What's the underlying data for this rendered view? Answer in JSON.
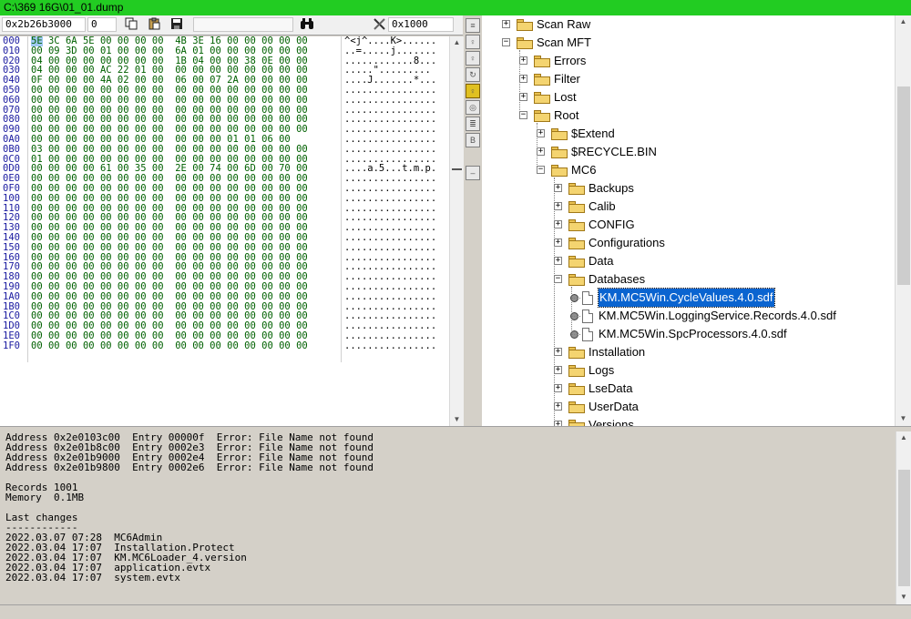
{
  "window": {
    "title": "C:\\369 16G\\01_01.dump"
  },
  "hex_toolbar": {
    "address": "0x2b26b3000",
    "offset": "0",
    "search_value": "",
    "zoom": "0x1000"
  },
  "hex": {
    "rows": [
      {
        "addr": "000",
        "bytes": [
          "5E",
          "3C",
          "6A",
          "5E",
          "00",
          "00",
          "00",
          "00",
          "4B",
          "3E",
          "16",
          "00",
          "00",
          "00",
          "00",
          "00"
        ],
        "ascii": "^<j^....K>......"
      },
      {
        "addr": "010",
        "bytes": [
          "00",
          "09",
          "3D",
          "00",
          "01",
          "00",
          "00",
          "00",
          "6A",
          "01",
          "00",
          "00",
          "00",
          "00",
          "00",
          "00"
        ],
        "ascii": "..=.....j......."
      },
      {
        "addr": "020",
        "bytes": [
          "04",
          "00",
          "00",
          "00",
          "00",
          "00",
          "00",
          "00",
          "1B",
          "04",
          "00",
          "00",
          "38",
          "0E",
          "00",
          "00"
        ],
        "ascii": "............8..."
      },
      {
        "addr": "030",
        "bytes": [
          "04",
          "00",
          "00",
          "00",
          "AC",
          "22",
          "01",
          "00",
          "00",
          "00",
          "00",
          "00",
          "00",
          "00",
          "00",
          "00"
        ],
        "ascii": ".....\"........."
      },
      {
        "addr": "040",
        "bytes": [
          "0F",
          "00",
          "00",
          "00",
          "4A",
          "02",
          "00",
          "00",
          "06",
          "00",
          "07",
          "2A",
          "00",
          "00",
          "00",
          "00"
        ],
        "ascii": "....J.......*..."
      },
      {
        "addr": "050",
        "bytes": [
          "00",
          "00",
          "00",
          "00",
          "00",
          "00",
          "00",
          "00",
          "00",
          "00",
          "00",
          "00",
          "00",
          "00",
          "00",
          "00"
        ],
        "ascii": "................"
      },
      {
        "addr": "060",
        "bytes": [
          "00",
          "00",
          "00",
          "00",
          "00",
          "00",
          "00",
          "00",
          "00",
          "00",
          "00",
          "00",
          "00",
          "00",
          "00",
          "00"
        ],
        "ascii": "................"
      },
      {
        "addr": "070",
        "bytes": [
          "00",
          "00",
          "00",
          "00",
          "00",
          "00",
          "00",
          "00",
          "00",
          "00",
          "00",
          "00",
          "00",
          "00",
          "00",
          "00"
        ],
        "ascii": "................"
      },
      {
        "addr": "080",
        "bytes": [
          "00",
          "00",
          "00",
          "00",
          "00",
          "00",
          "00",
          "00",
          "00",
          "00",
          "00",
          "00",
          "00",
          "00",
          "00",
          "00"
        ],
        "ascii": "................"
      },
      {
        "addr": "090",
        "bytes": [
          "00",
          "00",
          "00",
          "00",
          "00",
          "00",
          "00",
          "00",
          "00",
          "00",
          "00",
          "00",
          "00",
          "00",
          "00",
          "00"
        ],
        "ascii": "................"
      },
      {
        "addr": "0A0",
        "bytes": [
          "00",
          "00",
          "00",
          "00",
          "00",
          "00",
          "00",
          "00",
          "00",
          "00",
          "00",
          "01",
          "01",
          "06",
          "00"
        ],
        "ascii": "................"
      },
      {
        "addr": "0B0",
        "bytes": [
          "03",
          "00",
          "00",
          "00",
          "00",
          "00",
          "00",
          "00",
          "00",
          "00",
          "00",
          "00",
          "00",
          "00",
          "00",
          "00"
        ],
        "ascii": "................"
      },
      {
        "addr": "0C0",
        "bytes": [
          "01",
          "00",
          "00",
          "00",
          "00",
          "00",
          "00",
          "00",
          "00",
          "00",
          "00",
          "00",
          "00",
          "00",
          "00",
          "00"
        ],
        "ascii": "................"
      },
      {
        "addr": "0D0",
        "bytes": [
          "00",
          "00",
          "00",
          "00",
          "61",
          "00",
          "35",
          "00",
          "2E",
          "00",
          "74",
          "00",
          "6D",
          "00",
          "70",
          "00"
        ],
        "ascii": "....a.5...t.m.p."
      },
      {
        "addr": "0E0",
        "bytes": [
          "00",
          "00",
          "00",
          "00",
          "00",
          "00",
          "00",
          "00",
          "00",
          "00",
          "00",
          "00",
          "00",
          "00",
          "00",
          "00"
        ],
        "ascii": "................"
      },
      {
        "addr": "0F0",
        "bytes": [
          "00",
          "00",
          "00",
          "00",
          "00",
          "00",
          "00",
          "00",
          "00",
          "00",
          "00",
          "00",
          "00",
          "00",
          "00",
          "00"
        ],
        "ascii": "................"
      },
      {
        "addr": "100",
        "bytes": [
          "00",
          "00",
          "00",
          "00",
          "00",
          "00",
          "00",
          "00",
          "00",
          "00",
          "00",
          "00",
          "00",
          "00",
          "00",
          "00"
        ],
        "ascii": "................"
      },
      {
        "addr": "110",
        "bytes": [
          "00",
          "00",
          "00",
          "00",
          "00",
          "00",
          "00",
          "00",
          "00",
          "00",
          "00",
          "00",
          "00",
          "00",
          "00",
          "00"
        ],
        "ascii": "................"
      },
      {
        "addr": "120",
        "bytes": [
          "00",
          "00",
          "00",
          "00",
          "00",
          "00",
          "00",
          "00",
          "00",
          "00",
          "00",
          "00",
          "00",
          "00",
          "00",
          "00"
        ],
        "ascii": "................"
      },
      {
        "addr": "130",
        "bytes": [
          "00",
          "00",
          "00",
          "00",
          "00",
          "00",
          "00",
          "00",
          "00",
          "00",
          "00",
          "00",
          "00",
          "00",
          "00",
          "00"
        ],
        "ascii": "................"
      },
      {
        "addr": "140",
        "bytes": [
          "00",
          "00",
          "00",
          "00",
          "00",
          "00",
          "00",
          "00",
          "00",
          "00",
          "00",
          "00",
          "00",
          "00",
          "00",
          "00"
        ],
        "ascii": "................"
      },
      {
        "addr": "150",
        "bytes": [
          "00",
          "00",
          "00",
          "00",
          "00",
          "00",
          "00",
          "00",
          "00",
          "00",
          "00",
          "00",
          "00",
          "00",
          "00",
          "00"
        ],
        "ascii": "................"
      },
      {
        "addr": "160",
        "bytes": [
          "00",
          "00",
          "00",
          "00",
          "00",
          "00",
          "00",
          "00",
          "00",
          "00",
          "00",
          "00",
          "00",
          "00",
          "00",
          "00"
        ],
        "ascii": "................"
      },
      {
        "addr": "170",
        "bytes": [
          "00",
          "00",
          "00",
          "00",
          "00",
          "00",
          "00",
          "00",
          "00",
          "00",
          "00",
          "00",
          "00",
          "00",
          "00",
          "00"
        ],
        "ascii": "................"
      },
      {
        "addr": "180",
        "bytes": [
          "00",
          "00",
          "00",
          "00",
          "00",
          "00",
          "00",
          "00",
          "00",
          "00",
          "00",
          "00",
          "00",
          "00",
          "00",
          "00"
        ],
        "ascii": "................"
      },
      {
        "addr": "190",
        "bytes": [
          "00",
          "00",
          "00",
          "00",
          "00",
          "00",
          "00",
          "00",
          "00",
          "00",
          "00",
          "00",
          "00",
          "00",
          "00",
          "00"
        ],
        "ascii": "................"
      },
      {
        "addr": "1A0",
        "bytes": [
          "00",
          "00",
          "00",
          "00",
          "00",
          "00",
          "00",
          "00",
          "00",
          "00",
          "00",
          "00",
          "00",
          "00",
          "00",
          "00"
        ],
        "ascii": "................"
      },
      {
        "addr": "1B0",
        "bytes": [
          "00",
          "00",
          "00",
          "00",
          "00",
          "00",
          "00",
          "00",
          "00",
          "00",
          "00",
          "00",
          "00",
          "00",
          "00",
          "00"
        ],
        "ascii": "................"
      },
      {
        "addr": "1C0",
        "bytes": [
          "00",
          "00",
          "00",
          "00",
          "00",
          "00",
          "00",
          "00",
          "00",
          "00",
          "00",
          "00",
          "00",
          "00",
          "00",
          "00"
        ],
        "ascii": "................"
      },
      {
        "addr": "1D0",
        "bytes": [
          "00",
          "00",
          "00",
          "00",
          "00",
          "00",
          "00",
          "00",
          "00",
          "00",
          "00",
          "00",
          "00",
          "00",
          "00",
          "00"
        ],
        "ascii": "................"
      },
      {
        "addr": "1E0",
        "bytes": [
          "00",
          "00",
          "00",
          "00",
          "00",
          "00",
          "00",
          "00",
          "00",
          "00",
          "00",
          "00",
          "00",
          "00",
          "00",
          "00"
        ],
        "ascii": "................"
      },
      {
        "addr": "1F0",
        "bytes": [
          "00",
          "00",
          "00",
          "00",
          "00",
          "00",
          "00",
          "00",
          "00",
          "00",
          "00",
          "00",
          "00",
          "00",
          "00",
          "00"
        ],
        "ascii": "................"
      }
    ]
  },
  "tree": {
    "nodes": [
      {
        "label": "Scan Raw",
        "depth": 0,
        "state": "collapsed",
        "kind": "folder"
      },
      {
        "label": "Scan MFT",
        "depth": 0,
        "state": "expanded",
        "kind": "folder"
      },
      {
        "label": "Errors",
        "depth": 1,
        "state": "collapsed",
        "kind": "folder"
      },
      {
        "label": "Filter",
        "depth": 1,
        "state": "collapsed",
        "kind": "folder"
      },
      {
        "label": "Lost",
        "depth": 1,
        "state": "collapsed",
        "kind": "folder"
      },
      {
        "label": "Root",
        "depth": 1,
        "state": "expanded",
        "kind": "folder"
      },
      {
        "label": "$Extend",
        "depth": 2,
        "state": "collapsed",
        "kind": "folder"
      },
      {
        "label": "$RECYCLE.BIN",
        "depth": 2,
        "state": "collapsed",
        "kind": "folder"
      },
      {
        "label": "MC6",
        "depth": 2,
        "state": "expanded",
        "kind": "folder"
      },
      {
        "label": "Backups",
        "depth": 3,
        "state": "collapsed",
        "kind": "folder"
      },
      {
        "label": "Calib",
        "depth": 3,
        "state": "collapsed",
        "kind": "folder"
      },
      {
        "label": "CONFIG",
        "depth": 3,
        "state": "collapsed",
        "kind": "folder"
      },
      {
        "label": "Configurations",
        "depth": 3,
        "state": "collapsed",
        "kind": "folder"
      },
      {
        "label": "Data",
        "depth": 3,
        "state": "collapsed",
        "kind": "folder"
      },
      {
        "label": "Databases",
        "depth": 3,
        "state": "expanded",
        "kind": "folder"
      },
      {
        "label": "KM.MC5Win.CycleValues.4.0.sdf",
        "depth": 4,
        "state": "leaf",
        "kind": "file",
        "selected": true
      },
      {
        "label": "KM.MC5Win.LoggingService.Records.4.0.sdf",
        "depth": 4,
        "state": "leaf",
        "kind": "file"
      },
      {
        "label": "KM.MC5Win.SpcProcessors.4.0.sdf",
        "depth": 4,
        "state": "leaf",
        "kind": "file"
      },
      {
        "label": "Installation",
        "depth": 3,
        "state": "collapsed",
        "kind": "folder"
      },
      {
        "label": "Logs",
        "depth": 3,
        "state": "collapsed",
        "kind": "folder"
      },
      {
        "label": "LseData",
        "depth": 3,
        "state": "collapsed",
        "kind": "folder"
      },
      {
        "label": "UserData",
        "depth": 3,
        "state": "collapsed",
        "kind": "folder"
      },
      {
        "label": "Versions",
        "depth": 3,
        "state": "collapsed",
        "kind": "folder"
      }
    ]
  },
  "log": {
    "lines": [
      "Address 0x2e0103c00  Entry 00000f  Error: File Name not found",
      "Address 0x2e01b8c00  Entry 0002e3  Error: File Name not found",
      "Address 0x2e01b9000  Entry 0002e4  Error: File Name not found",
      "Address 0x2e01b9800  Entry 0002e6  Error: File Name not found",
      "",
      "Records 1001",
      "Memory  0.1MB",
      "",
      "Last changes",
      "------------",
      "2022.03.07 07:28  MC6Admin",
      "2022.03.04 17:07  Installation.Protect",
      "2022.03.04 17:07  KM.MC6Loader_4.version",
      "2022.03.04 17:07  application.evtx",
      "2022.03.04 17:07  system.evtx"
    ]
  },
  "icons": {
    "copy": "copy-icon",
    "paste": "paste-icon",
    "save": "save-icon",
    "find": "binoculars-icon",
    "tools": "tools-icon"
  },
  "colors": {
    "titlebar": "#22cc22",
    "hex_address": "#1a1aa0",
    "hex_bytes": "#006000",
    "selection": "#0a64d0",
    "folder": "#f4d470"
  }
}
